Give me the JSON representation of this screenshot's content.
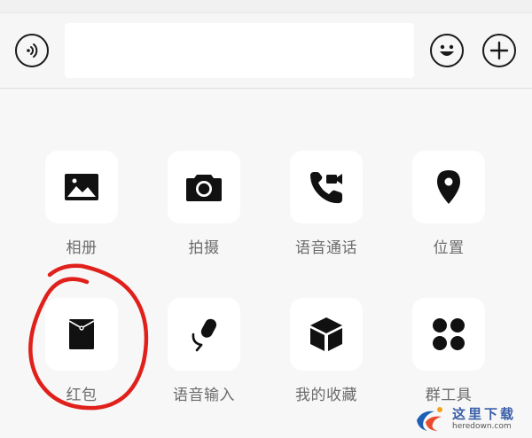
{
  "input_bar": {
    "voice_icon": "voice-wave-icon",
    "emoji_icon": "smiley-icon",
    "plus_icon": "plus-icon",
    "text_value": ""
  },
  "panel": {
    "items": [
      {
        "label": "相册",
        "icon": "photo-album-icon"
      },
      {
        "label": "拍摄",
        "icon": "camera-icon"
      },
      {
        "label": "语音通话",
        "icon": "voice-video-call-icon"
      },
      {
        "label": "位置",
        "icon": "location-pin-icon"
      },
      {
        "label": "红包",
        "icon": "red-packet-icon"
      },
      {
        "label": "语音输入",
        "icon": "microphone-icon"
      },
      {
        "label": "我的收藏",
        "icon": "favorites-cube-icon"
      },
      {
        "label": "群工具",
        "icon": "group-tools-icon"
      }
    ]
  },
  "annotation": {
    "color": "#e0201b",
    "target": "红包"
  },
  "watermark": {
    "chinese": "这里下载",
    "url": "heredown.com"
  }
}
